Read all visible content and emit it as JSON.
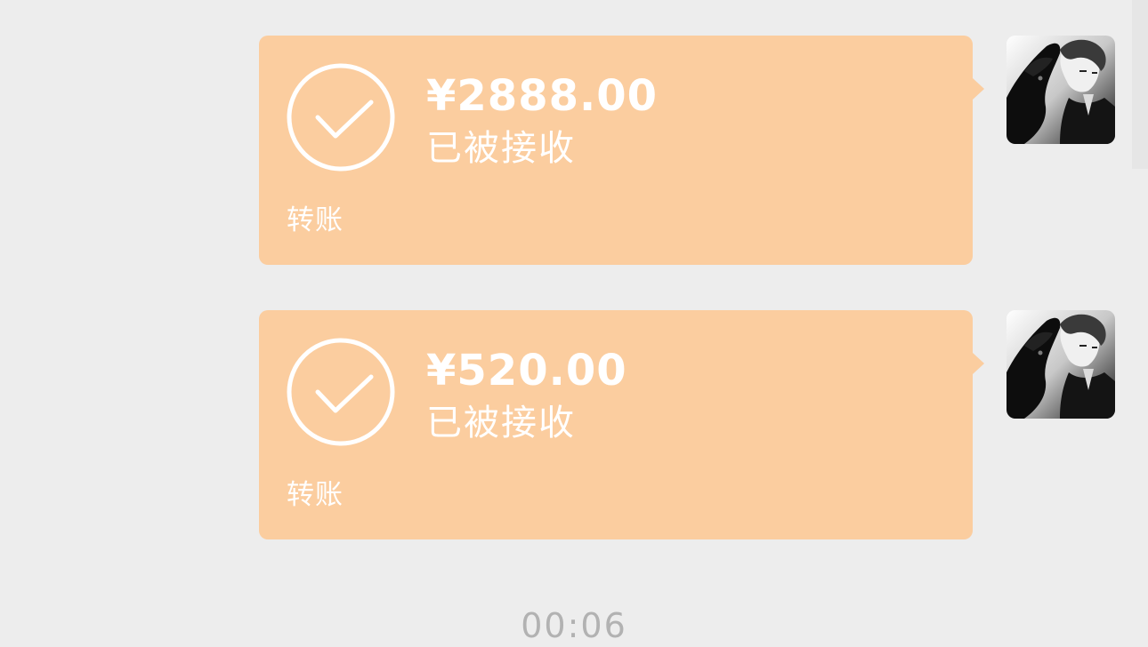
{
  "messages": [
    {
      "amount": "¥2888.00",
      "status": "已被接收",
      "type_label": "转账",
      "icon": "check-circle-icon",
      "avatar": "user-avatar"
    },
    {
      "amount": "¥520.00",
      "status": "已被接收",
      "type_label": "转账",
      "icon": "check-circle-icon",
      "avatar": "user-avatar"
    }
  ],
  "timestamp": "00:06",
  "colors": {
    "background": "#ededed",
    "bubble": "#fbcd9f",
    "text": "#ffffff",
    "timestamp": "#b2b2b2"
  }
}
